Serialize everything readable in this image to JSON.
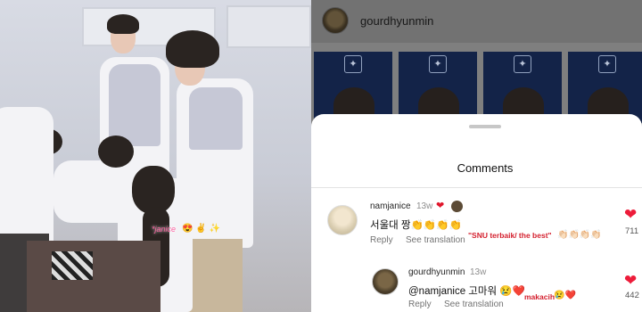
{
  "video": {
    "sticker_text": "*janice",
    "sticker_emoji": "😍 ✌ ✨"
  },
  "instagram": {
    "header": {
      "username": "gourdhyunmin",
      "more_icon": "more-vertical-icon"
    },
    "grid": {
      "tiles": 4
    },
    "comments_sheet": {
      "title": "Comments",
      "comments": [
        {
          "username": "namjanice",
          "time": "13w",
          "text": "서울대 짱👏👏👏👏",
          "reply_label": "Reply",
          "translate_label": "See translation",
          "likes": "711",
          "overlay_caption": "\"SNU terbaik/ the best\"",
          "overlay_emoji": "👏🏻👏🏻👏🏻👏🏻"
        },
        {
          "username": "gourdhyunmin",
          "time": "13w",
          "text": "@namjanice 고마워 😢❤️",
          "reply_label": "Reply",
          "translate_label": "See translation",
          "likes": "442",
          "overlay_caption": "makacih",
          "overlay_emoji": "😢❤️"
        }
      ]
    }
  },
  "colors": {
    "like_red": "#ed1c3a",
    "caption_red": "#d4202e",
    "tile_navy": "#15264f"
  }
}
